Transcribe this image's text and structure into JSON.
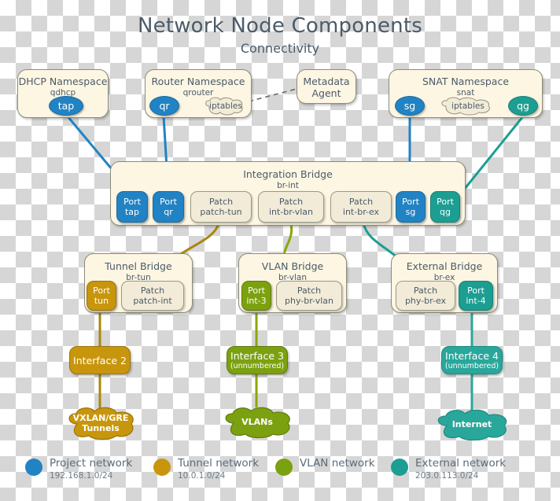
{
  "header": {
    "title": "Network Node Components",
    "subtitle": "Connectivity"
  },
  "namespaces": {
    "dhcp": {
      "title": "DHCP Namespace",
      "sub": "qdhcp",
      "port": "tap"
    },
    "router": {
      "title": "Router Namespace",
      "sub": "qrouter",
      "port": "qr",
      "cloud": "iptables"
    },
    "metadata": {
      "line1": "Metadata",
      "line2": "Agent"
    },
    "snat": {
      "title": "SNAT Namespace",
      "sub": "snat",
      "port_in": "sg",
      "cloud": "iptables",
      "port_out": "qg"
    }
  },
  "integration_bridge": {
    "title": "Integration Bridge",
    "sub": "br-int",
    "ports": [
      {
        "kind": "Port",
        "name": "tap",
        "color": "blue"
      },
      {
        "kind": "Port",
        "name": "qr",
        "color": "blue"
      },
      {
        "kind": "Patch",
        "name": "patch-tun",
        "color": "cream"
      },
      {
        "kind": "Patch",
        "name": "int-br-vlan",
        "color": "cream"
      },
      {
        "kind": "Patch",
        "name": "int-br-ex",
        "color": "cream"
      },
      {
        "kind": "Port",
        "name": "sg",
        "color": "blue"
      },
      {
        "kind": "Port",
        "name": "qg",
        "color": "teal"
      }
    ]
  },
  "bridges": [
    {
      "title": "Tunnel Bridge",
      "sub": "br-tun",
      "ports": [
        {
          "kind": "Port",
          "name": "tun",
          "color": "gold"
        },
        {
          "kind": "Patch",
          "name": "patch-int",
          "color": "cream"
        }
      ]
    },
    {
      "title": "VLAN Bridge",
      "sub": "br-vlan",
      "ports": [
        {
          "kind": "Port",
          "name": "int-3",
          "color": "olive"
        },
        {
          "kind": "Patch",
          "name": "phy-br-vlan",
          "color": "cream"
        }
      ]
    },
    {
      "title": "External Bridge",
      "sub": "br-ex",
      "ports": [
        {
          "kind": "Patch",
          "name": "phy-br-ex",
          "color": "cream"
        },
        {
          "kind": "Port",
          "name": "int-4",
          "color": "teal"
        }
      ]
    }
  ],
  "interfaces": [
    {
      "name": "Interface 2",
      "note": "",
      "color": "gold"
    },
    {
      "name": "Interface 3",
      "note": "(unnumbered)",
      "color": "olive"
    },
    {
      "name": "Interface 4",
      "note": "(unnumbered)",
      "color": "teal"
    }
  ],
  "clouds": [
    {
      "line1": "VXLAN/GRE",
      "line2": "Tunnels",
      "color": "gold"
    },
    {
      "line1": "VLANs",
      "line2": "",
      "color": "olive"
    },
    {
      "line1": "Internet",
      "line2": "",
      "color": "teal"
    }
  ],
  "legend": [
    {
      "name": "Project network",
      "subnet": "192.168.1.0/24",
      "color": "#2183c4"
    },
    {
      "name": "Tunnel network",
      "subnet": "10.0.1.0/24",
      "color": "#c8960c"
    },
    {
      "name": "VLAN network",
      "subnet": "",
      "color": "#7ca110"
    },
    {
      "name": "External network",
      "subnet": "203.0.113.0/24",
      "color": "#1c9e92"
    }
  ]
}
